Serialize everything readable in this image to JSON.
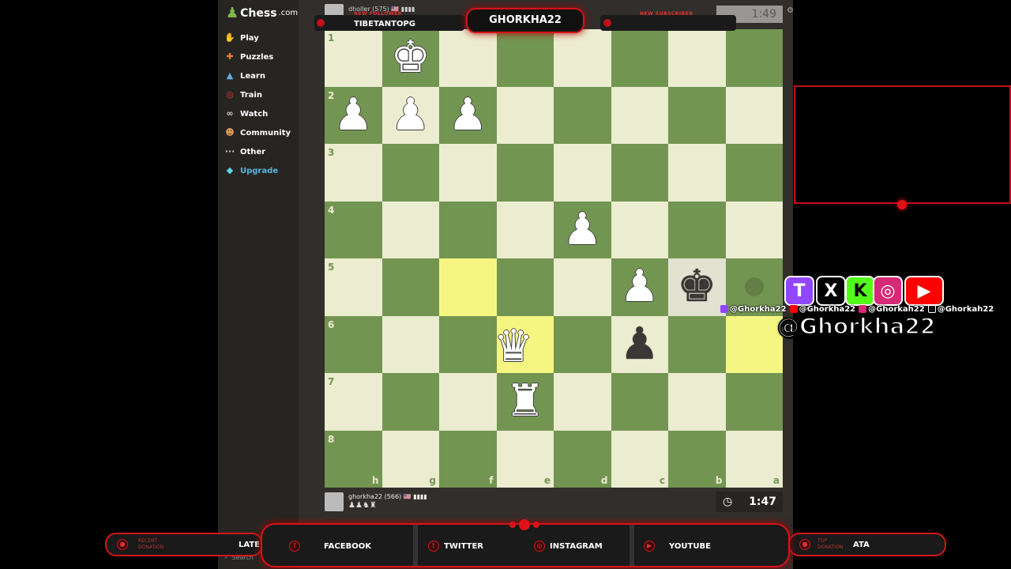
{
  "sidebar": {
    "logo": {
      "name": "Chess",
      "domain": ".com"
    },
    "items": [
      {
        "label": "Play",
        "icon": "play-hand-icon"
      },
      {
        "label": "Puzzles",
        "icon": "puzzle-icon"
      },
      {
        "label": "Learn",
        "icon": "graduation-cap-icon"
      },
      {
        "label": "Train",
        "icon": "target-icon"
      },
      {
        "label": "Watch",
        "icon": "binoculars-icon"
      },
      {
        "label": "Community",
        "icon": "people-icon"
      },
      {
        "label": "Other",
        "icon": "more-dots-icon"
      },
      {
        "label": "Upgrade",
        "icon": "diamond-icon"
      }
    ],
    "search": "Search"
  },
  "top_player": {
    "name": "dholler (575) 🇺🇸 ▮▮▮▮",
    "clock": "1:49"
  },
  "bottom_player": {
    "name": "ghorkha22 (566) 🇺🇸 ▮▮▮▮",
    "captured": "♟♟♞♜",
    "clock": "1:47"
  },
  "board": {
    "ranks": [
      "1",
      "2",
      "3",
      "4",
      "5",
      "6",
      "7",
      "8"
    ],
    "files": [
      "h",
      "g",
      "f",
      "e",
      "d",
      "c",
      "b",
      "a"
    ],
    "highlights": [
      [
        2,
        4
      ],
      [
        3,
        5
      ],
      [
        7,
        5
      ]
    ],
    "check_square": [
      6,
      4
    ],
    "move_dots": [
      [
        7,
        4
      ]
    ],
    "pieces": [
      {
        "col": 1,
        "row": 0,
        "glyph": "♚",
        "color": "w"
      },
      {
        "col": 0,
        "row": 1,
        "glyph": "♟",
        "color": "w"
      },
      {
        "col": 1,
        "row": 1,
        "glyph": "♟",
        "color": "w"
      },
      {
        "col": 2,
        "row": 1,
        "glyph": "♟",
        "color": "w"
      },
      {
        "col": 4,
        "row": 3,
        "glyph": "♟",
        "color": "w"
      },
      {
        "col": 5,
        "row": 4,
        "glyph": "♟",
        "color": "w"
      },
      {
        "col": 6,
        "row": 4,
        "glyph": "♚",
        "color": "b"
      },
      {
        "col": 2.8,
        "row": 5.05,
        "glyph": "♛",
        "color": "w"
      },
      {
        "col": 5,
        "row": 5,
        "glyph": "♟",
        "color": "b"
      },
      {
        "col": 3,
        "row": 6,
        "glyph": "♜",
        "color": "w"
      }
    ]
  },
  "overlay": {
    "title": "GHORKHA22",
    "new_follower_label": "NEW FOLLOWER",
    "new_follower_name": "TIBETANTOPG",
    "new_subscriber_label": "NEW SUBSCRIBER",
    "new_subscriber_name": "",
    "social_icons": [
      "T",
      "X",
      "K",
      "◎",
      "▶"
    ],
    "handles": [
      "@Ghorkha22",
      "@Ghorkha22",
      "@Ghorkah22",
      "@Ghorkah22"
    ],
    "big_handle": "@Ghorkha22",
    "recent_donation_label": "RECENT DONATION",
    "recent_donation_value": "LATE",
    "top_donation_label": "TOP DONATION",
    "top_donation_value": "ATA",
    "links": [
      "FACEBOOK",
      "TWITTER",
      "INSTAGRAM",
      "YOUTUBE"
    ]
  },
  "colors": {
    "accent": "#d4141c",
    "board_light": "#ebecd0",
    "board_dark": "#739552"
  }
}
